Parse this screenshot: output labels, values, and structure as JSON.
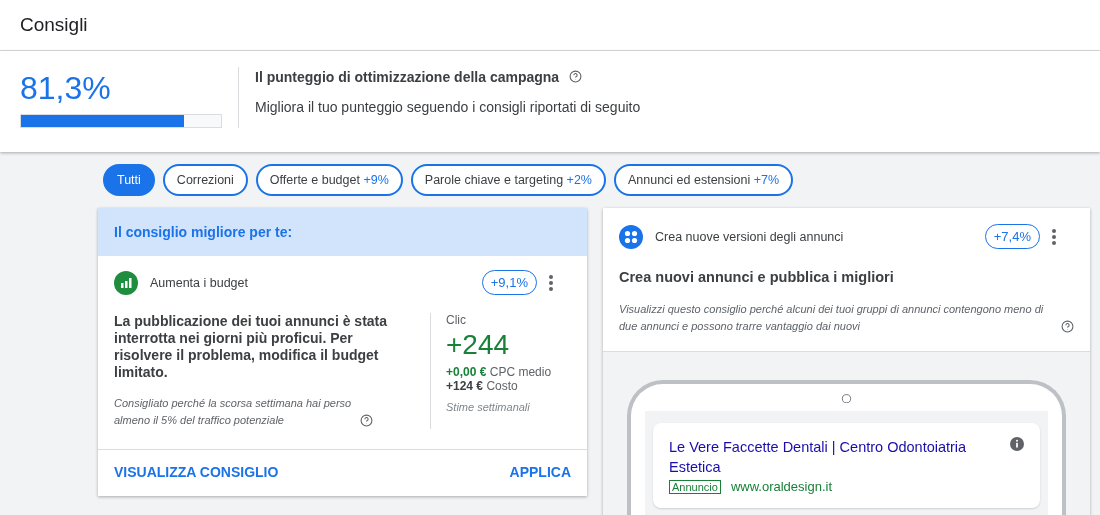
{
  "title": "Consigli",
  "score": {
    "value": "81,3%",
    "level": 0.813,
    "heading": "Il punteggio di ottimizzazione della campagna",
    "subtitle": "Migliora il tuo punteggio seguendo i consigli riportati di seguito"
  },
  "filters": [
    {
      "label": "Tutti",
      "selected": true
    },
    {
      "label": "Correzioni",
      "selected": false
    },
    {
      "label": "Offerte e budget",
      "delta": "+9%",
      "selected": false
    },
    {
      "label": "Parole chiave e targeting",
      "delta": "+2%",
      "selected": false
    },
    {
      "label": "Annunci ed estensioni",
      "delta": "+7%",
      "selected": false
    }
  ],
  "best_card": {
    "banner": "Il consiglio migliore per te:",
    "category": "Aumenta i budget",
    "uplift": "+9,1%",
    "description": "La pubblicazione dei tuoi annunci è stata interrotta nei giorni più proficui. Per risolvere il problema, modifica il budget limitato.",
    "reason": "Consigliato perché la scorsa settimana hai perso almeno il 5% del traffico potenziale",
    "metric_label": "Clic",
    "metric_value": "+244",
    "cpc_value": "+0,00 €",
    "cpc_label": "CPC medio",
    "cost_value": "+124 €",
    "cost_label": "Costo",
    "estimate_note": "Stime settimanali",
    "actions": [
      "VISUALIZZA CONSIGLIO",
      "APPLICA"
    ]
  },
  "ad_card": {
    "category": "Crea nuove versioni degli annunci",
    "uplift": "+7,4%",
    "heading": "Crea nuovi annunci e pubblica i migliori",
    "reason": "Visualizzi questo consiglio perché alcuni dei tuoi gruppi di annunci contengono meno di due annunci e possono trarre vantaggio dai nuovi",
    "ad": {
      "headline": "Le Vere Faccette Dentali | Centro Odontoiatria Estetica",
      "badge": "Annuncio",
      "url": "www.oraldesign.it"
    }
  }
}
